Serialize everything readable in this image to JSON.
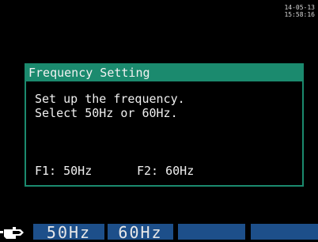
{
  "status": {
    "date": "14-05-13",
    "time": "15:58:16"
  },
  "dialog": {
    "title": "Frequency Setting",
    "message_line1": "Set up the frequency.",
    "message_line2": "Select 50Hz or 60Hz.",
    "key_hint_f1": "F1: 50Hz",
    "key_hint_f2": "F2: 60Hz"
  },
  "function_keys": [
    {
      "label": "50Hz"
    },
    {
      "label": "60Hz"
    },
    {
      "label": ""
    },
    {
      "label": ""
    }
  ],
  "colors": {
    "title_bar": "#1b8a6e",
    "function_key": "#1d4f8a",
    "background": "#000000"
  }
}
